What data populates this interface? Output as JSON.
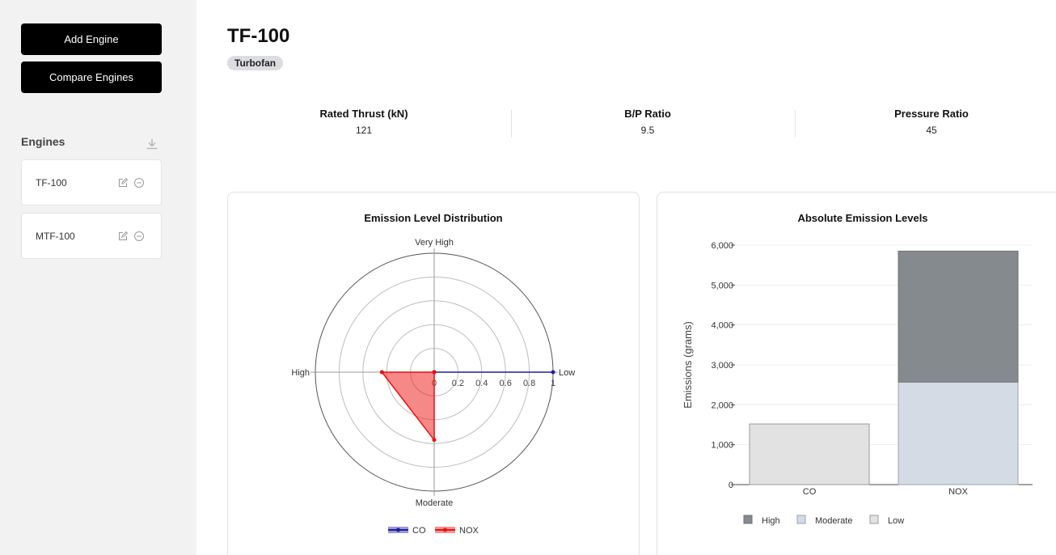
{
  "sidebar": {
    "add_button": "Add Engine",
    "compare_button": "Compare Engines",
    "section_title": "Engines",
    "engines": [
      {
        "name": "TF-100"
      },
      {
        "name": "MTF-100"
      }
    ]
  },
  "engine": {
    "title": "TF-100",
    "type_badge": "Turbofan",
    "stats": [
      {
        "label": "Rated Thrust (kN)",
        "value": "121"
      },
      {
        "label": "B/P Ratio",
        "value": "9.5"
      },
      {
        "label": "Pressure Ratio",
        "value": "45"
      }
    ]
  },
  "colors": {
    "sidebar_bg": "#f2f2f2",
    "button_bg": "#000000",
    "co_line": "#1f1f9e",
    "nox_line": "#ee1111",
    "high": "#858a8f",
    "moderate": "#d4dbe4",
    "low": "#e2e2e3"
  },
  "chart_data": [
    {
      "type": "radar",
      "title": "Emission Level Distribution",
      "axes": [
        "Very High",
        "Low",
        "Moderate",
        "High"
      ],
      "radial_ticks": [
        "0",
        "0.2",
        "0.4",
        "0.6",
        "0.8",
        "1"
      ],
      "range": [
        0,
        1
      ],
      "series": [
        {
          "name": "CO",
          "values": [
            0,
            1,
            0,
            0
          ]
        },
        {
          "name": "NOX",
          "values": [
            0,
            0,
            0.57,
            0.44
          ]
        }
      ],
      "legend": "bottom"
    },
    {
      "type": "bar",
      "stacked": true,
      "title": "Absolute Emission Levels",
      "categories": [
        "CO",
        "NOX"
      ],
      "ylabel": "Emissions (grams)",
      "ylim": [
        0,
        6000
      ],
      "yticks": [
        "0",
        "1,000",
        "2,000",
        "3,000",
        "4,000",
        "5,000",
        "6,000"
      ],
      "series": [
        {
          "name": "Low",
          "values": [
            1520,
            0
          ]
        },
        {
          "name": "Moderate",
          "values": [
            0,
            2570
          ]
        },
        {
          "name": "High",
          "values": [
            0,
            3280
          ]
        }
      ],
      "legend_order": [
        "High",
        "Moderate",
        "Low"
      ],
      "legend": "bottom"
    }
  ]
}
